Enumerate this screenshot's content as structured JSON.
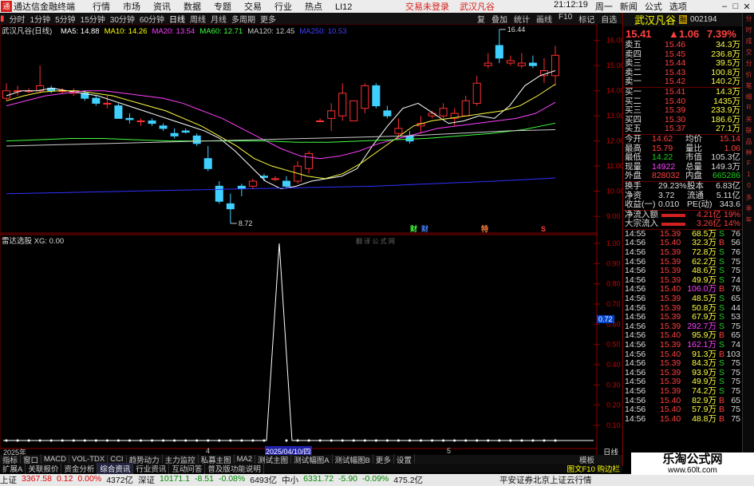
{
  "titlebar": {
    "app_name": "通达信金融终端",
    "menu": [
      "行情",
      "市场",
      "资讯",
      "数据",
      "专题",
      "交易",
      "行业",
      "热点",
      "LI12"
    ],
    "center": [
      "交易未登录",
      "武汉凡谷"
    ],
    "time": "21:12:19",
    "right_menu": [
      "周一",
      "新闻",
      "公式",
      "选项"
    ]
  },
  "periodbar": {
    "items": [
      "分时",
      "1分钟",
      "5分钟",
      "15分钟",
      "30分钟",
      "60分钟",
      "日线",
      "周线",
      "月线",
      "多周期",
      "更多"
    ],
    "active": "日线",
    "right_items": [
      "复",
      "叠加",
      "统计",
      "画线",
      "F10",
      "标记",
      "自选"
    ]
  },
  "chart": {
    "stock_title": "武汉凡谷(日线)",
    "ma_legend": [
      {
        "label": "MA5: 14.88",
        "color": "#ffffff"
      },
      {
        "label": "MA10: 14.26",
        "color": "#ffff00"
      },
      {
        "label": "MA20: 13.54",
        "color": "#ff40ff"
      },
      {
        "label": "MA60: 12.71",
        "color": "#40ff40"
      },
      {
        "label": "MA120: 12.45",
        "color": "#cccccc"
      },
      {
        "label": "MA250: 10.53",
        "color": "#4040ff"
      }
    ],
    "price_ticks": [
      "16.00",
      "15.00",
      "14.00",
      "13.00",
      "12.00",
      "11.00",
      "10.00",
      "9.00"
    ],
    "high_label": "16.44",
    "low_label": "8.72",
    "markers": [
      {
        "text": "财",
        "color": "#40ff40"
      },
      {
        "text": "财",
        "color": "#4080ff"
      },
      {
        "text": "特",
        "color": "#ff8040"
      },
      {
        "text": "S",
        "color": "#ff4040"
      }
    ],
    "indicator_title": "雷达选股 XG: 0.00",
    "indicator_watermark": "翻 译 公 式 网",
    "indicator_ticks": [
      "1.00",
      "0.90",
      "0.80",
      "0.70",
      "0.60",
      "0.50",
      "0.40",
      "0.30",
      "0.20",
      "0.10"
    ],
    "indicator_cursor": "0.72",
    "xaxis_year": "2025年",
    "xaxis_month4": "4",
    "xaxis_cursor": "2025/04/10/四",
    "xaxis_month5": "5",
    "period_label": "日线"
  },
  "quote": {
    "name": "武汉凡谷",
    "tag": "融",
    "code": "002194",
    "price": "15.41",
    "change": "▲1.06",
    "pct": "7.39%",
    "asks": [
      {
        "lv": "卖五",
        "p": "15.46",
        "v": "34.3万"
      },
      {
        "lv": "卖四",
        "p": "15.45",
        "v": "236.8万"
      },
      {
        "lv": "卖三",
        "p": "15.44",
        "v": "39.5万"
      },
      {
        "lv": "卖二",
        "p": "15.43",
        "v": "100.8万"
      },
      {
        "lv": "卖一",
        "p": "15.42",
        "v": "140.2万"
      }
    ],
    "bids": [
      {
        "lv": "买一",
        "p": "15.41",
        "v": "14.3万"
      },
      {
        "lv": "买二",
        "p": "15.40",
        "v": "1435万"
      },
      {
        "lv": "买三",
        "p": "15.39",
        "v": "233.9万"
      },
      {
        "lv": "买四",
        "p": "15.30",
        "v": "186.6万"
      },
      {
        "lv": "买五",
        "p": "15.37",
        "v": "27.1万"
      }
    ],
    "stats": [
      {
        "k1": "今开",
        "v1": "14.62",
        "c1": "red",
        "k2": "均价",
        "v2": "15.14",
        "c2": "red"
      },
      {
        "k1": "最高",
        "v1": "15.79",
        "c1": "red",
        "k2": "量比",
        "v2": "1.06",
        "c2": "red"
      },
      {
        "k1": "最低",
        "v1": "14.22",
        "c1": "grn",
        "k2": "市值",
        "v2": "105.3亿",
        "c2": "wht"
      },
      {
        "k1": "现量",
        "v1": "14922",
        "c1": "mag",
        "k2": "总量",
        "v2": "149.3万",
        "c2": "wht"
      },
      {
        "k1": "外盘",
        "v1": "828032",
        "c1": "red",
        "k2": "内盘",
        "v2": "665286",
        "c2": "grn"
      }
    ],
    "fund": [
      {
        "k1": "换手",
        "v1": "29.23%",
        "k2": "股本",
        "v2": "6.83亿"
      },
      {
        "k1": "净资",
        "v1": "3.72",
        "k2": "流通",
        "v2": "5.11亿"
      },
      {
        "k1": "收益(一)",
        "v1": "0.010",
        "k2": "PE(动)",
        "v2": "343.6"
      }
    ],
    "flows": [
      {
        "k": "净流入额",
        "v": "4.21亿",
        "p": "19%"
      },
      {
        "k": "大宗流入",
        "v": "3.26亿",
        "p": "14%"
      }
    ],
    "ticks": [
      {
        "t": "14:55",
        "p": "15.39",
        "v": "68.5万",
        "s": "S",
        "n": "76"
      },
      {
        "t": "14:56",
        "p": "15.40",
        "v": "32.3万",
        "s": "B",
        "n": "56"
      },
      {
        "t": "14:56",
        "p": "15.39",
        "v": "72.8万",
        "s": "S",
        "n": "76"
      },
      {
        "t": "14:56",
        "p": "15.39",
        "v": "62.2万",
        "s": "S",
        "n": "75"
      },
      {
        "t": "14:56",
        "p": "15.39",
        "v": "48.6万",
        "s": "S",
        "n": "75"
      },
      {
        "t": "14:56",
        "p": "15.39",
        "v": "49.9万",
        "s": "S",
        "n": "74"
      },
      {
        "t": "14:56",
        "p": "15.40",
        "v": "106.0万",
        "s": "B",
        "n": "76"
      },
      {
        "t": "14:56",
        "p": "15.39",
        "v": "48.5万",
        "s": "S",
        "n": "65"
      },
      {
        "t": "14:56",
        "p": "15.39",
        "v": "50.8万",
        "s": "S",
        "n": "44"
      },
      {
        "t": "14:56",
        "p": "15.39",
        "v": "67.9万",
        "s": "S",
        "n": "53"
      },
      {
        "t": "14:56",
        "p": "15.39",
        "v": "292.7万",
        "s": "S",
        "n": "75"
      },
      {
        "t": "14:56",
        "p": "15.40",
        "v": "95.9万",
        "s": "B",
        "n": "65"
      },
      {
        "t": "14:56",
        "p": "15.39",
        "v": "162.1万",
        "s": "S",
        "n": "74"
      },
      {
        "t": "14:56",
        "p": "15.40",
        "v": "91.3万",
        "s": "B",
        "n": "103"
      },
      {
        "t": "14:56",
        "p": "15.39",
        "v": "84.3万",
        "s": "S",
        "n": "75"
      },
      {
        "t": "14:56",
        "p": "15.39",
        "v": "93.9万",
        "s": "S",
        "n": "75"
      },
      {
        "t": "14:56",
        "p": "15.39",
        "v": "49.9万",
        "s": "S",
        "n": "75"
      },
      {
        "t": "14:56",
        "p": "15.39",
        "v": "74.2万",
        "s": "S",
        "n": "75"
      },
      {
        "t": "14:56",
        "p": "15.40",
        "v": "82.9万",
        "s": "B",
        "n": "65"
      },
      {
        "t": "14:56",
        "p": "15.40",
        "v": "57.9万",
        "s": "B",
        "n": "75"
      },
      {
        "t": "14:56",
        "p": "15.40",
        "v": "48.8万",
        "s": "B",
        "n": "75"
      }
    ]
  },
  "sidestrip": [
    "分",
    "时",
    "成",
    "交",
    "分",
    "价",
    "笔",
    "细",
    "R",
    "关",
    "联",
    "品",
    "种",
    "F",
    "1",
    "0",
    "多",
    "季",
    "年"
  ],
  "tabbar": {
    "items": [
      "指标",
      "窗口",
      "MACD",
      "VOL-TDX",
      "CCI",
      "趋势动力",
      "主力监控",
      "私募主图",
      "MA2",
      "测试主图",
      "测试幅图A",
      "测试幅图B",
      "更多",
      "设置"
    ],
    "right": "模板"
  },
  "subbar": {
    "items": [
      "扩展A",
      "关联报价",
      "资金分析",
      "综合资讯",
      "行业资讯",
      "互动问答",
      "普及版功能说明"
    ],
    "active": "综合资讯",
    "right": "图文F10 购边栏"
  },
  "statusbar": {
    "items": [
      {
        "text": "上证",
        "c": ""
      },
      {
        "text": "3367.58",
        "c": "r"
      },
      {
        "text": "0.12",
        "c": "r"
      },
      {
        "text": "0.00%",
        "c": "r"
      },
      {
        "text": "4372亿",
        "c": ""
      },
      {
        "text": "深证",
        "c": ""
      },
      {
        "text": "10171.1",
        "c": "g"
      },
      {
        "text": "-8.51",
        "c": "g"
      },
      {
        "text": "-0.08%",
        "c": "g"
      },
      {
        "text": "6493亿",
        "c": ""
      },
      {
        "text": "中小",
        "c": ""
      },
      {
        "text": "6331.72",
        "c": "g"
      },
      {
        "text": "-5.90",
        "c": "g"
      },
      {
        "text": "-0.09%",
        "c": "g"
      },
      {
        "text": "475.2亿",
        "c": ""
      }
    ],
    "right": "平安证券北京上证云行情"
  },
  "watermark": {
    "line1": "乐淘公式网",
    "line2": "www.60lt.com"
  }
}
